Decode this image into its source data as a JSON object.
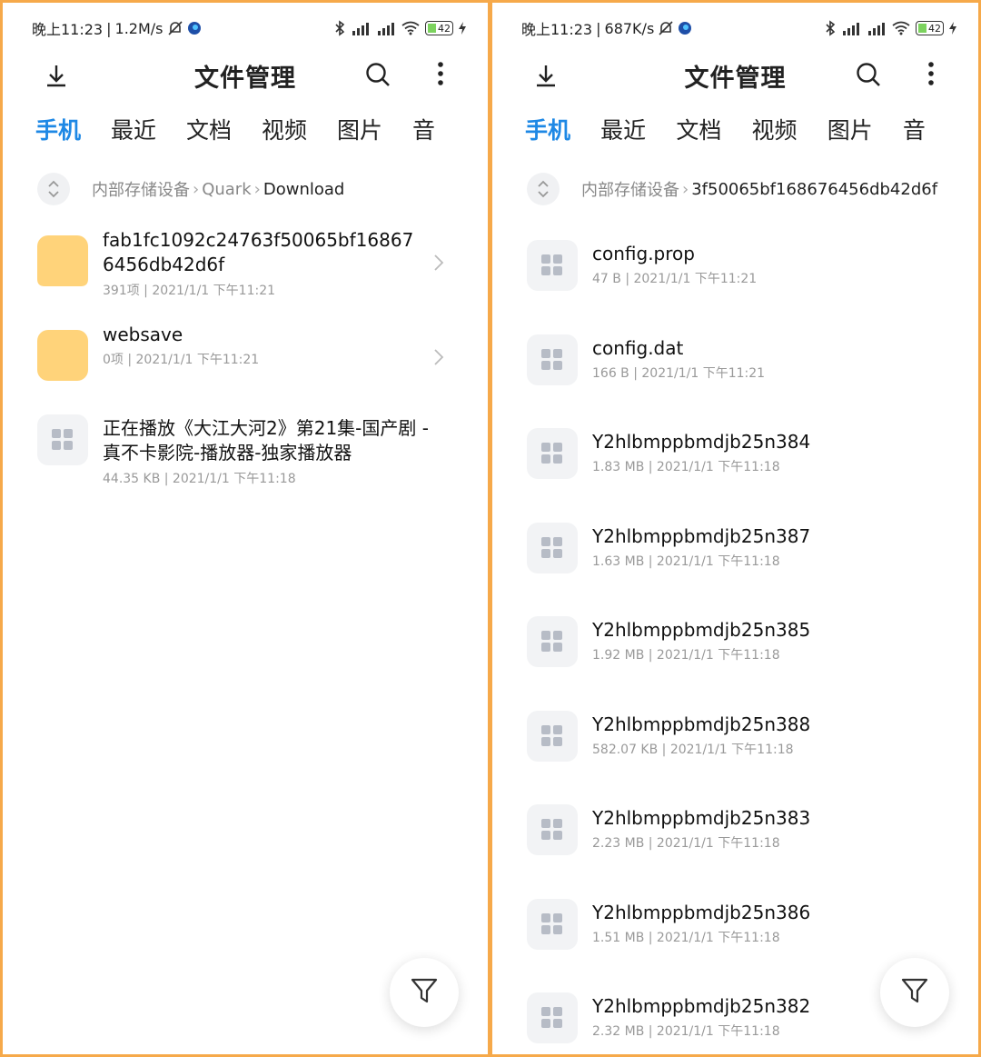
{
  "accent_color": "#1e88e5",
  "border_color": "#f6a94a",
  "left": {
    "status": {
      "time": "晚上11:23",
      "speed": "1.2M/s",
      "battery": "42"
    },
    "title": "文件管理",
    "tabs": [
      "手机",
      "最近",
      "文档",
      "视频",
      "图片",
      "音"
    ],
    "breadcrumb": [
      "内部存储设备",
      "Quark",
      "Download"
    ],
    "items": [
      {
        "type": "folder",
        "name": "fab1fc1092c24763f50065bf168676456db42d6f",
        "meta": "391项 | 2021/1/1 下午11:21"
      },
      {
        "type": "folder",
        "name": "websave",
        "meta": "0项 | 2021/1/1 下午11:21"
      },
      {
        "type": "file",
        "name": "正在播放《大江大河2》第21集-国产剧 - 真不卡影院-播放器-独家播放器",
        "meta": "44.35 KB | 2021/1/1 下午11:18"
      }
    ]
  },
  "right": {
    "status": {
      "time": "晚上11:23",
      "speed": "687K/s",
      "battery": "42"
    },
    "title": "文件管理",
    "tabs": [
      "手机",
      "最近",
      "文档",
      "视频",
      "图片",
      "音"
    ],
    "breadcrumb": [
      "内部存储设备",
      "3f50065bf168676456db42d6f"
    ],
    "items": [
      {
        "type": "file",
        "name": "config.prop",
        "meta": "47 B | 2021/1/1 下午11:21"
      },
      {
        "type": "file",
        "name": "config.dat",
        "meta": "166 B | 2021/1/1 下午11:21"
      },
      {
        "type": "file",
        "name": "Y2hlbmppbmdjb25n384",
        "meta": "1.83 MB | 2021/1/1 下午11:18"
      },
      {
        "type": "file",
        "name": "Y2hlbmppbmdjb25n387",
        "meta": "1.63 MB | 2021/1/1 下午11:18"
      },
      {
        "type": "file",
        "name": "Y2hlbmppbmdjb25n385",
        "meta": "1.92 MB | 2021/1/1 下午11:18"
      },
      {
        "type": "file",
        "name": "Y2hlbmppbmdjb25n388",
        "meta": "582.07 KB | 2021/1/1 下午11:18"
      },
      {
        "type": "file",
        "name": "Y2hlbmppbmdjb25n383",
        "meta": "2.23 MB | 2021/1/1 下午11:18"
      },
      {
        "type": "file",
        "name": "Y2hlbmppbmdjb25n386",
        "meta": "1.51 MB | 2021/1/1 下午11:18"
      },
      {
        "type": "file",
        "name": "Y2hlbmppbmdjb25n382",
        "meta": "2.32 MB | 2021/1/1 下午11:18"
      }
    ]
  }
}
